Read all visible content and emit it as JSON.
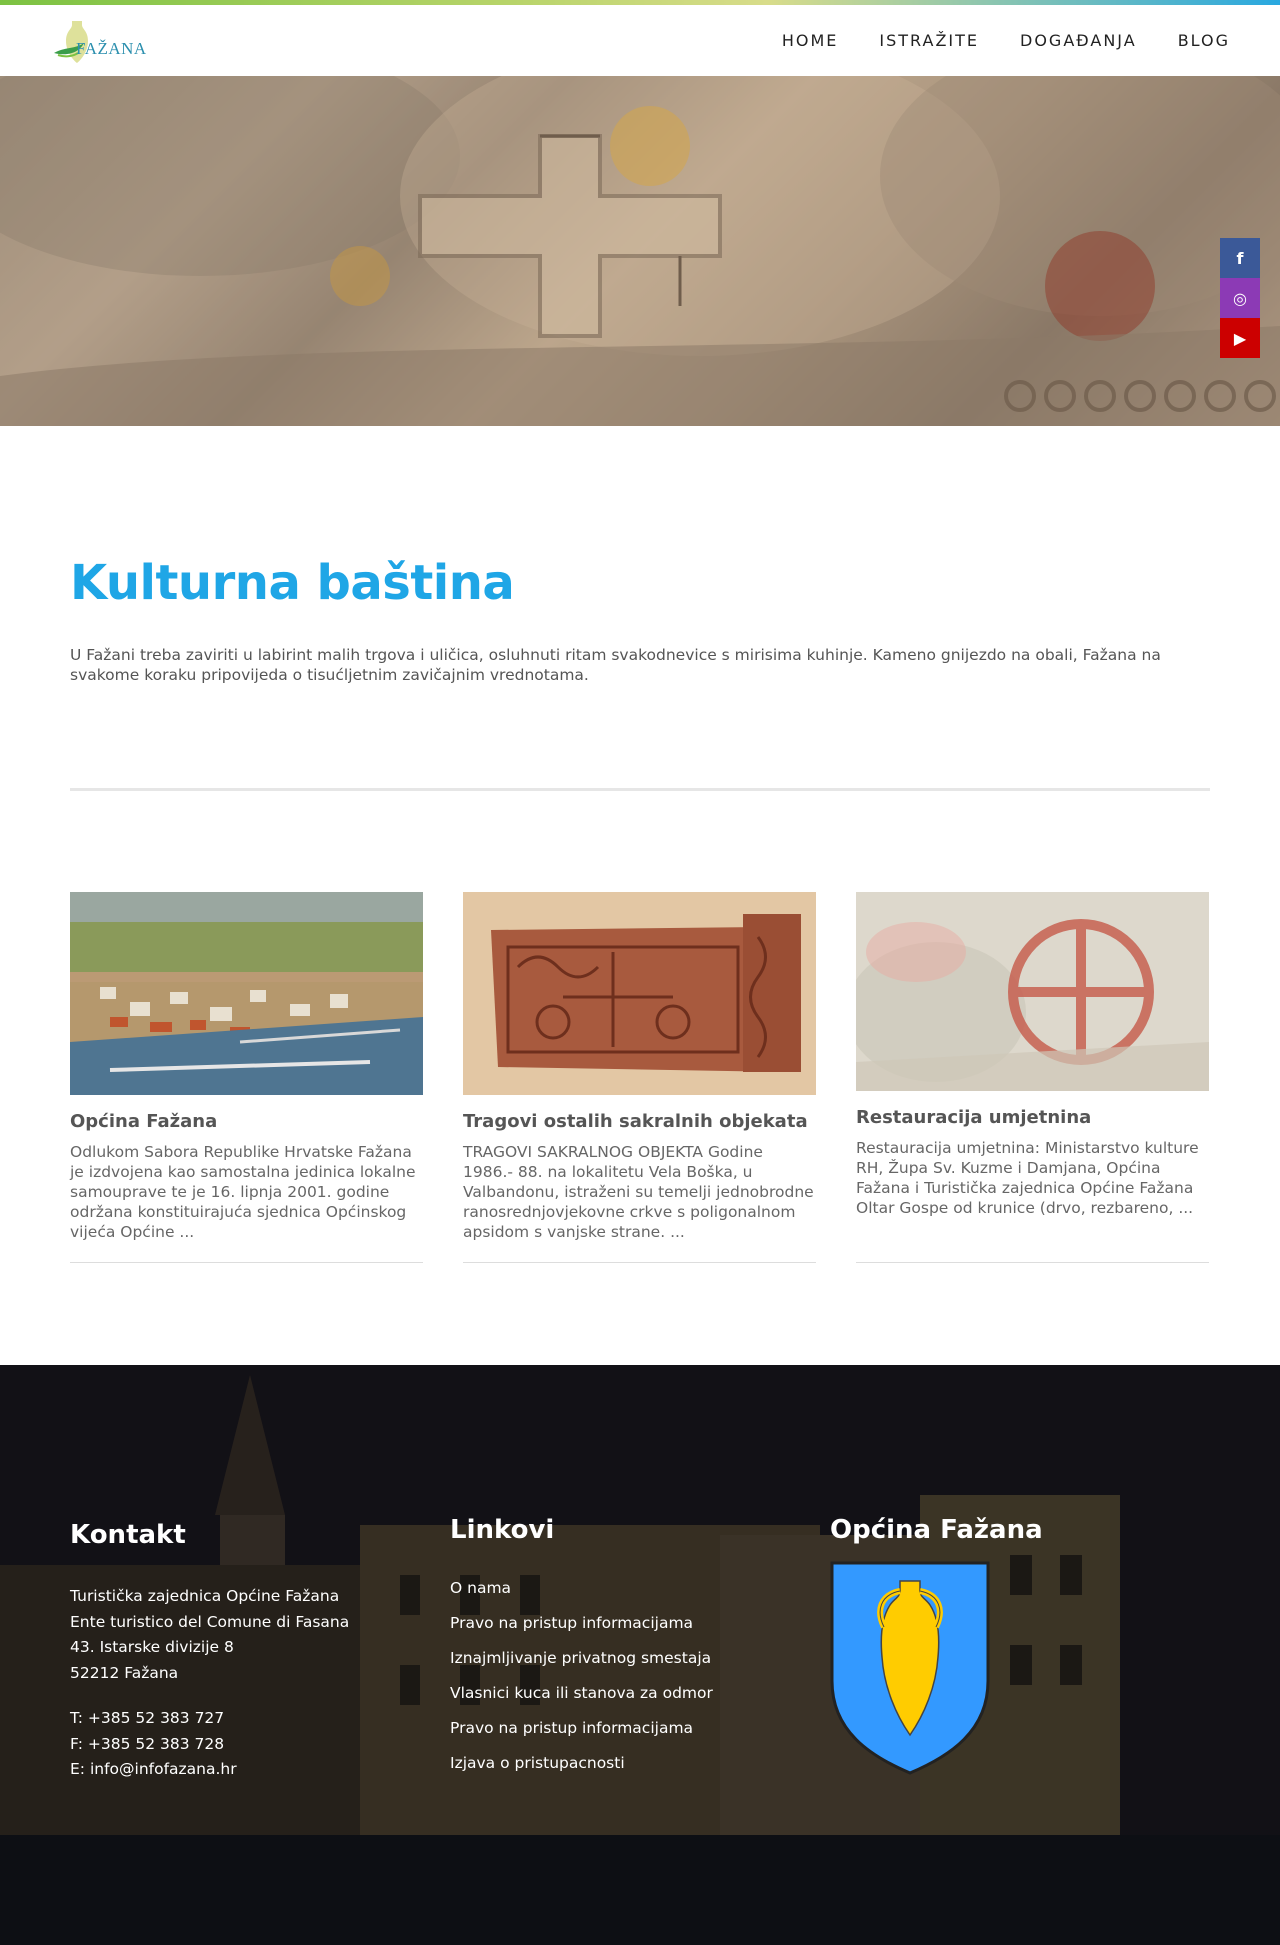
{
  "brand": {
    "logo_text": "FAŽANA"
  },
  "nav": {
    "items": [
      "HOME",
      "ISTRAŽITE",
      "DOGAĐANJA",
      "BLOG"
    ]
  },
  "social": {
    "facebook": "f",
    "instagram": "◎",
    "youtube": "▶"
  },
  "intro": {
    "title": "Kulturna baština",
    "text": "U Fažani treba zaviriti u labirint malih trgova i uličica, osluhnuti ritam svakodnevice s mirisima kuhinje. Kameno gnijezdo na obali, Fažana na svakome koraku pripovijeda o tisućljetnim zavičajnim vrednotama."
  },
  "cards": [
    {
      "title": "Općina Fažana",
      "text": "Odlukom Sabora Republike Hrvatske Fažana je izdvojena kao samostalna jedinica lokalne samouprave te je 16. lipnja 2001. godine održana konstituirajuća sjednica Općinskog vijeća Općine ...",
      "more": ""
    },
    {
      "title": "Tragovi ostalih sakralnih objekata",
      "text": "TRAGOVI SAKRALNOG OBJEKTA Godine 1986.- 88. na lokalitetu Vela Boška, u Valbandonu, istraženi su temelji jednobrodne ranosrednjovjekovne crkve s poligonalnom apsidom s vanjske strane. ...",
      "more": ""
    },
    {
      "title": "Restauracija umjetnina",
      "text": "Restauracija umjetnina: Ministarstvo kulture RH, Župa Sv. Kuzme i Damjana, Općina Fažana i Turistička zajednica Općine Fažana",
      "more": "Oltar Gospe od krunice (drvo, rezbareno, ..."
    }
  ],
  "footer": {
    "contact": {
      "title": "Kontakt",
      "lines": [
        "Turistička zajednica Općine Fažana",
        "Ente turistico del Comune di Fasana",
        "43. Istarske divizije 8",
        "52212 Fažana"
      ],
      "phone": "T: +385 52 383 727",
      "fax": "F: +385 52 383 728",
      "email": "E: info@infofazana.hr"
    },
    "links": {
      "title": "Linkovi",
      "items": [
        "O nama",
        "Pravo na pristup informacijama",
        "Iznajmljivanje privatnog smestaja",
        "Vlasnici kuca ili stanova za odmor",
        "Pravo na pristup informacijama",
        "Izjava o pristupacnosti"
      ]
    },
    "opcina": {
      "title": "Općina Fažana"
    }
  },
  "colors": {
    "accent": "#1fa6e6",
    "shield": "#3399ff",
    "amphora": "#ffcc00"
  }
}
